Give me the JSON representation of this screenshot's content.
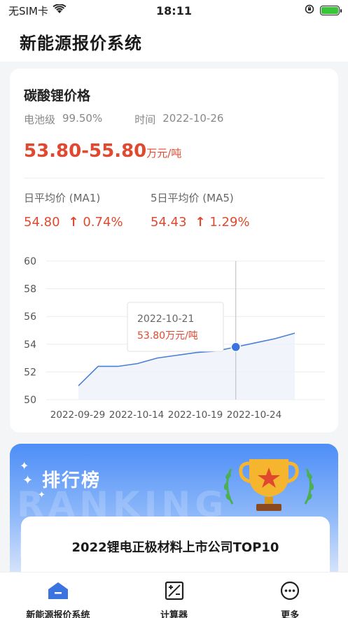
{
  "status_bar": {
    "carrier": "无SIM卡",
    "time": "18:11"
  },
  "header": {
    "title": "新能源报价系统"
  },
  "price_card": {
    "title": "碳酸锂价格",
    "grade_label": "电池级",
    "grade_value": "99.50%",
    "time_label": "时间",
    "time_value": "2022-10-26",
    "price_range": "53.80-55.80",
    "price_unit": "万元/吨",
    "ma1": {
      "label": "日平均价 (MA1)",
      "price": "54.80",
      "change": "0.74%"
    },
    "ma5": {
      "label": "5日平均价 (MA5)",
      "price": "54.43",
      "change": "1.29%"
    }
  },
  "chart_data": {
    "type": "line",
    "y_ticks": [
      "60",
      "58",
      "56",
      "54",
      "52",
      "50"
    ],
    "ylim": [
      50,
      60
    ],
    "x_tick_labels": [
      "2022-09-29",
      "2022-10-14",
      "2022-10-19",
      "2022-10-24"
    ],
    "values": [
      51.0,
      52.4,
      52.4,
      52.6,
      53.0,
      53.2,
      53.4,
      53.5,
      53.8,
      54.1,
      54.4,
      54.8
    ],
    "tooltip": {
      "date": "2022-10-21",
      "value": "53.80万元/吨"
    },
    "highlight_index": 8,
    "grid": true,
    "line_color": "#4a7fd6",
    "highlight_color": "#3b74e0"
  },
  "ranking": {
    "title": "排行榜",
    "background_text": "RANKING LIST",
    "heading": "2022锂电正极材料上市公司TOP10"
  },
  "tabs": [
    {
      "label": "新能源报价系统",
      "icon": "home-icon"
    },
    {
      "label": "计算器",
      "icon": "calculator-icon"
    },
    {
      "label": "更多",
      "icon": "more-icon"
    }
  ],
  "colors": {
    "accent_red": "#e0492f",
    "brand_blue": "#3b74e0"
  }
}
